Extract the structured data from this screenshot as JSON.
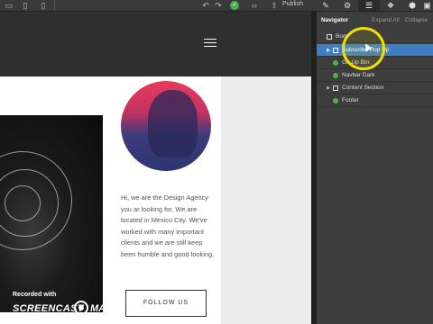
{
  "toolbar": {
    "publish_label": "Publish",
    "tools": [
      "desktop-icon",
      "tablet-icon",
      "undo-icon",
      "redo-icon",
      "code-icon",
      "publish-icon",
      "brush-icon",
      "gear-icon",
      "navigator-icon",
      "cubes-icon",
      "box-icon"
    ]
  },
  "canvas": {
    "about_text": "Hi, we are the Design Agency you ar looking for. We are located in Mexico City. We've worked with many important clients and we are still keep been humble and good looking.",
    "follow_label": "FOLLOW US",
    "watermark": {
      "recorded": "Recorded with",
      "brand_left": "SCREENCAST",
      "brand_right": "MATIC"
    }
  },
  "navigator": {
    "title": "Navigator",
    "expand_all": "Expand All",
    "collapse": "Collapse",
    "items": [
      {
        "label": "Body",
        "icon": "box-icon",
        "indent": 0,
        "has_children": false,
        "selected": false
      },
      {
        "label": "Subscribe Pop Up",
        "icon": "box-icon",
        "indent": 1,
        "has_children": true,
        "selected": true
      },
      {
        "label": "Go Up Btn",
        "icon": "component-icon",
        "indent": 1,
        "has_children": false,
        "selected": false
      },
      {
        "label": "Navbar Dark",
        "icon": "component-icon",
        "indent": 1,
        "has_children": false,
        "selected": false
      },
      {
        "label": "Content Section",
        "icon": "box-icon",
        "indent": 1,
        "has_children": true,
        "selected": false
      },
      {
        "label": "Footer",
        "icon": "component-icon",
        "indent": 1,
        "has_children": false,
        "selected": false
      }
    ]
  },
  "colors": {
    "selected_row": "#3e7fc4",
    "component_dot": "#4caf50",
    "cursor_highlight": "#f0e000"
  }
}
